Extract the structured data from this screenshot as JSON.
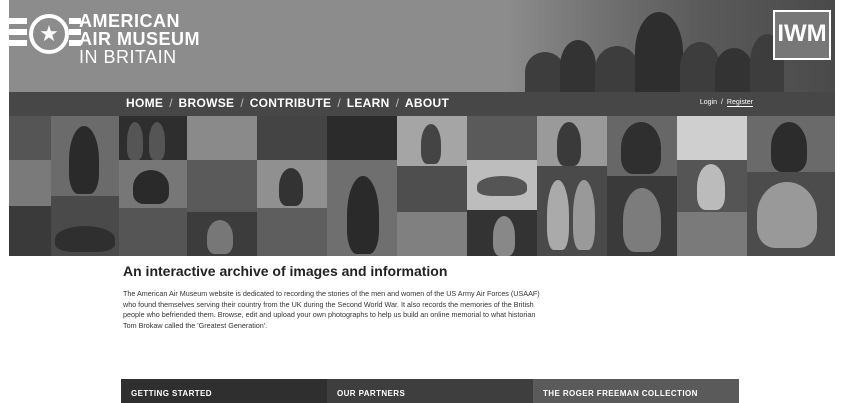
{
  "site": {
    "logo_line1": "AMERICAN",
    "logo_line2": "AIR MUSEUM",
    "logo_line3": "IN BRITAIN",
    "partner_badge": "IWM"
  },
  "nav": {
    "items": [
      "HOME",
      "BROWSE",
      "CONTRIBUTE",
      "LEARN",
      "ABOUT"
    ],
    "separator": "/"
  },
  "account": {
    "login": "Login",
    "separator": "/",
    "register": "Register"
  },
  "intro": {
    "heading": "An interactive archive of images and information",
    "body": "The American Air Museum website is dedicated to recording the stories of the men and women of the US Army Air Forces (USAAF) who found themselves serving their country from the UK during the Second World War. It also records the memories of the British people who befriended them. Browse, edit and upload your own photographs to help us build an online memorial to what historian Tom Brokaw called the 'Greatest Generation'."
  },
  "tabs": [
    "GETTING STARTED",
    "OUR PARTNERS",
    "THE ROGER FREEMAN COLLECTION"
  ],
  "colors": {
    "header_bg": "#8c8c8c",
    "nav_bg": "#474747",
    "tab_dark": "#2f2f2f",
    "tab_mid": "#3e3e3e",
    "tab_light": "#5a5a5a"
  },
  "icons": {
    "logo_mark": "star-roundel-icon"
  }
}
